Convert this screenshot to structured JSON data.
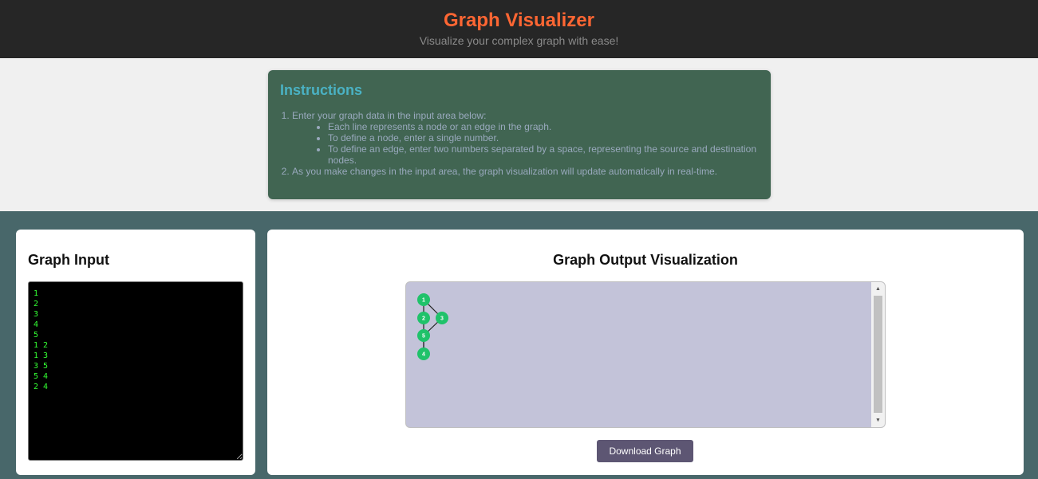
{
  "header": {
    "title": "Graph Visualizer",
    "subtitle": "Visualize your complex graph with ease!"
  },
  "instructions": {
    "title": "Instructions",
    "step1": "Enter your graph data in the input area below:",
    "step1_bullets": [
      "Each line represents a node or an edge in the graph.",
      "To define a node, enter a single number.",
      "To define an edge, enter two numbers separated by a space, representing the source and destination nodes."
    ],
    "step2": "As you make changes in the input area, the graph visualization will update automatically in real-time."
  },
  "input_panel": {
    "title": "Graph Input",
    "text": "1\n2\n3\n4\n5\n1 2\n1 3\n3 5\n5 4\n2 4"
  },
  "output_panel": {
    "title": "Graph Output Visualization",
    "download_label": "Download Graph"
  },
  "graph": {
    "nodes": [
      "1",
      "2",
      "3",
      "5",
      "4"
    ],
    "edges": [
      [
        "1",
        "2"
      ],
      [
        "1",
        "3"
      ],
      [
        "3",
        "5"
      ],
      [
        "5",
        "4"
      ],
      [
        "2",
        "4"
      ]
    ]
  },
  "colors": {
    "title": "#ff6633",
    "node": "#1fc26a",
    "canvas_bg": "#c3c3d9",
    "button_bg": "#5d5673"
  }
}
